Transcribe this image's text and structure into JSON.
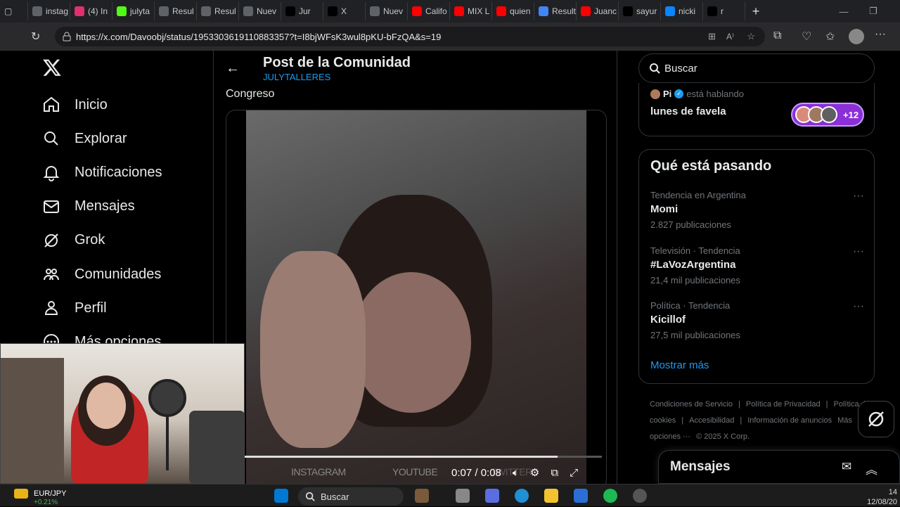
{
  "browser": {
    "tabs": [
      {
        "label": "instag",
        "color": "#5f6368"
      },
      {
        "label": "(4) In",
        "color": "#e1306c"
      },
      {
        "label": "julyta",
        "color": "#53fc18"
      },
      {
        "label": "Resul",
        "color": "#5f6368"
      },
      {
        "label": "Resul",
        "color": "#5f6368"
      },
      {
        "label": "Nuev",
        "color": "#5f6368"
      },
      {
        "label": "Jur ",
        "color": "#000000"
      },
      {
        "label": "X",
        "color": "#000000"
      },
      {
        "label": "Nuev",
        "color": "#5f6368"
      },
      {
        "label": "Califo",
        "color": "#ff0000"
      },
      {
        "label": "MIX L",
        "color": "#ff0000"
      },
      {
        "label": "quien",
        "color": "#ff0000"
      },
      {
        "label": "Result",
        "color": "#4285f4"
      },
      {
        "label": "Juanc",
        "color": "#ff0000"
      },
      {
        "label": "sayur",
        "color": "#000000"
      },
      {
        "label": "nicki",
        "color": "#0a84ff"
      },
      {
        "label": "r",
        "color": "#000000"
      }
    ],
    "url": "https://x.com/Davoobj/status/1953303619110883357?t=I8bjWFsK3wul8pKU-bFzQA&s=19"
  },
  "nav": {
    "items": [
      {
        "label": "Inicio",
        "icon": "home-icon"
      },
      {
        "label": "Explorar",
        "icon": "search-icon"
      },
      {
        "label": "Notificaciones",
        "icon": "bell-icon"
      },
      {
        "label": "Mensajes",
        "icon": "mail-icon"
      },
      {
        "label": "Grok",
        "icon": "grok-icon"
      },
      {
        "label": "Comunidades",
        "icon": "communities-icon"
      },
      {
        "label": "Perfil",
        "icon": "person-icon"
      },
      {
        "label": "Más opciones",
        "icon": "more-icon"
      }
    ]
  },
  "post": {
    "header_title": "Post de la Comunidad",
    "header_sub": "JULYTALLERES",
    "text": "Congreso",
    "video": {
      "time": "0:07 / 0:08",
      "progress": 0.875,
      "watermarks": [
        "INSTAGRAM",
        "YOUTUBE",
        "TWITTER"
      ]
    }
  },
  "sidebar": {
    "search_placeholder": "Buscar",
    "space": {
      "host": "Pi",
      "status": "está hablando",
      "title": "lunes de favela",
      "count": "+12"
    },
    "trends_title": "Qué está pasando",
    "trends": [
      {
        "context": "Tendencia en Argentina",
        "name": "Momi",
        "count": "2.827 publicaciones"
      },
      {
        "context": "Televisión · Tendencia",
        "name": "#LaVozArgentina",
        "count": "21,4 mil publicaciones"
      },
      {
        "context": "Política · Tendencia",
        "name": "Kicillof",
        "count": "27,5 mil publicaciones"
      }
    ],
    "show_more": "Mostrar más",
    "footer": [
      "Condiciones de Servicio",
      "|",
      "Política de Privacidad",
      "|",
      "Política de cookies",
      "|",
      "Accesibilidad",
      "|",
      "Información de anuncios",
      "Más opciones ···",
      "© 2025 X Corp."
    ]
  },
  "messages": {
    "title": "Mensajes"
  },
  "taskbar": {
    "ticker": "EUR/JPY",
    "ticker_change": "+0.21%",
    "search": "Buscar",
    "time": "14",
    "date": "12/08/20"
  }
}
